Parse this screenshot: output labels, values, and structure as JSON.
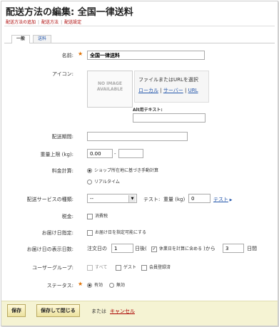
{
  "page": {
    "title": "配送方法の編集: 全国一律送料"
  },
  "breadcrumb": {
    "items": [
      "配送方法の追加",
      "配送方法",
      "配送設定"
    ]
  },
  "tabs": [
    {
      "label": "一般"
    },
    {
      "label": "送料"
    }
  ],
  "form": {
    "name": {
      "label": "名前:",
      "value": "全国一律送料"
    },
    "icon": {
      "label": "アイコン:",
      "no_image": "NO IMAGE AVAILABLE",
      "select_title": "ファイルまたはURLを選択",
      "local": "ローカル",
      "server": "サーバー",
      "url": "URL",
      "alt_label": "Alt用テキスト:"
    },
    "period": {
      "label": "配送期間:"
    },
    "weight": {
      "label": "重量上限 (kg):",
      "from": "0.00",
      "dash": "-"
    },
    "calc": {
      "label": "料金計算:",
      "options": [
        "ショップ所在地に基づき手動計算",
        "リアルタイム"
      ]
    },
    "service": {
      "label": "配送サービスの種類:",
      "value": "--",
      "test_label": "テスト:",
      "weight_label": "重量 (kg)",
      "weight_value": "0",
      "test_link": "テスト"
    },
    "tax": {
      "label": "税金:",
      "checkbox": "消費税"
    },
    "delivery_date": {
      "label": "お届け日指定:",
      "checkbox": "お届け日を指定可能にする"
    },
    "delivery_range": {
      "label": "お届け日の表示日数:",
      "prefix": "注文日の",
      "from": "1",
      "after": "日後(",
      "holiday": "休業日を計算に含める",
      "to_text": ")から",
      "to": "3",
      "suffix": "日間"
    },
    "user_group": {
      "label": "ユーザーグループ:",
      "options": [
        "すべて",
        "ゲスト",
        "会員登録済"
      ]
    },
    "status": {
      "label": "ステータス:",
      "options": [
        "有効",
        "無効"
      ]
    }
  },
  "footer": {
    "save": "保存",
    "save_close": "保存して閉じる",
    "or": "または",
    "cancel": "キャンセル"
  }
}
